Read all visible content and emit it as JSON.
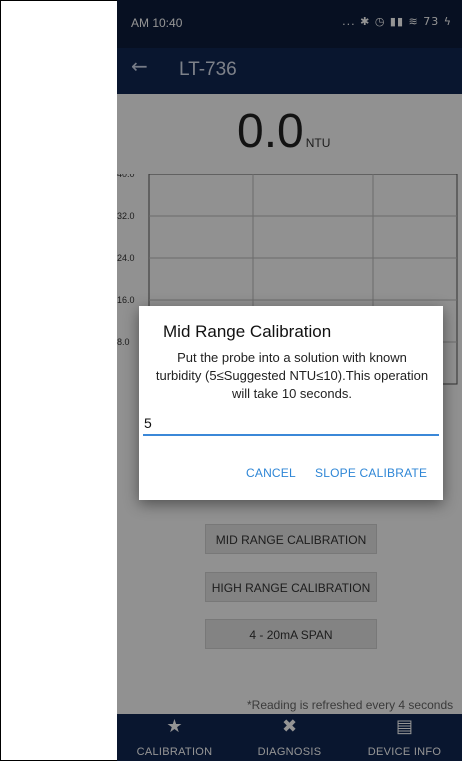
{
  "status_bar": {
    "time": "AM 10:40",
    "icons": "... ✱ ◷ ▮▮ ≋ 73 ϟ"
  },
  "app_bar": {
    "back_icon": "←",
    "title": "LT-736"
  },
  "reading": {
    "value": "0.0",
    "unit": "NTU"
  },
  "chart_data": {
    "type": "line",
    "y_ticks": [
      "40.0",
      "32.0",
      "24.0",
      "16.0",
      "8.0"
    ],
    "ylim": [
      0,
      40
    ],
    "grid": true,
    "series": []
  },
  "buttons": {
    "mid_range": "MID RANGE CALIBRATION",
    "high_range": "HIGH RANGE CALIBRATION",
    "span": "4 - 20mA SPAN"
  },
  "refresh_note": "*Reading is refreshed every 4 seconds",
  "nav": {
    "items": [
      {
        "icon": "★",
        "label": "CALIBRATION"
      },
      {
        "icon": "✖",
        "label": "DIAGNOSIS"
      },
      {
        "icon": "▤",
        "label": "DEVICE INFO"
      }
    ]
  },
  "dialog": {
    "title": "Mid Range Calibration",
    "message": "Put the probe into a solution with known turbidity (5≤Suggested NTU≤10).This operation will take 10 seconds.",
    "input_value": "5",
    "cancel": "CANCEL",
    "confirm": "SLOPE CALIBRATE"
  }
}
